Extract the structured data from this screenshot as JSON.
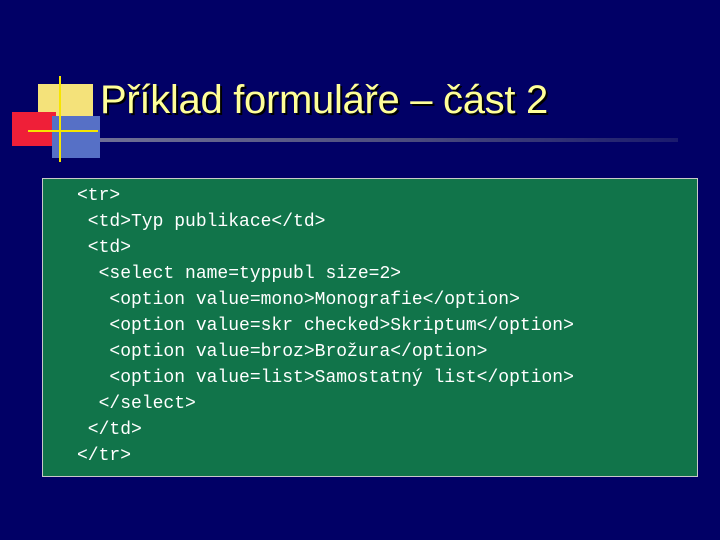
{
  "slide": {
    "title": "Příklad formuláře – část 2"
  },
  "code": {
    "lines": [
      "<tr>",
      " <td>Typ publikace</td>",
      " <td>",
      "  <select name=typpubl size=2>",
      "   <option value=mono>Monografie</option>",
      "   <option value=skr checked>Skriptum</option>",
      "   <option value=broz>Brožura</option>",
      "   <option value=list>Samostatný list</option>",
      "  </select>",
      " </td>",
      "</tr>"
    ]
  },
  "colors": {
    "background": "#010066",
    "title": "#ffff99",
    "code_box": "#11744a",
    "logo_yellow": "#f4e27a",
    "logo_red": "#ef1f38",
    "logo_blue": "#5670c6"
  }
}
